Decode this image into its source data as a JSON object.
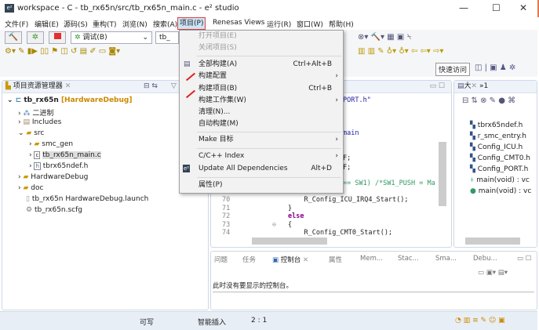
{
  "window": {
    "title": "workspace - C - tb_rx65n/src/tb_rx65n_main.c - e² studio",
    "minimize": "—",
    "maximize": "☐",
    "close": "✕"
  },
  "menubar": [
    "文件(F)",
    "编辑(E)",
    "源码(S)",
    "重构(T)",
    "浏览(N)",
    "搜索(A)",
    "项目(P)",
    "Renesas Views",
    "运行(R)",
    "窗口(W)",
    "帮助(H)"
  ],
  "toolbar": {
    "config_combo": "调试(B)",
    "target_combo": "tb_",
    "quick_access": "快速访问"
  },
  "explorer": {
    "title": "项目资源管理器",
    "items": [
      {
        "label": "tb_rx65n",
        "suffix": "[HardwareDebug]"
      },
      {
        "label": "二进制"
      },
      {
        "label": "Includes"
      },
      {
        "label": "src"
      },
      {
        "label": "smc_gen"
      },
      {
        "label": "tb_rx65n_main.c"
      },
      {
        "label": "tbrx65ndef.h"
      },
      {
        "label": "HardwareDebug"
      },
      {
        "label": "doc"
      },
      {
        "label": "tb_rx65n HardwareDebug.launch"
      },
      {
        "label": "tb_rx65n.scfg"
      }
    ]
  },
  "project_menu": {
    "items": [
      {
        "label": "打开项目(E)",
        "disabled": true
      },
      {
        "label": "关闭项目(S)",
        "disabled": true
      },
      {
        "label": "全部构建(A)",
        "shortcut": "Ctrl+Alt+B"
      },
      {
        "label": "构建配置",
        "submenu": "›"
      },
      {
        "label": "构建项目(B)",
        "shortcut": "Ctrl+B"
      },
      {
        "label": "构建工作集(W)",
        "submenu": "›"
      },
      {
        "label": "清理(N)..."
      },
      {
        "label": "自动构建(M)"
      },
      {
        "label": "Make 目标",
        "submenu": "›"
      },
      {
        "label": "C/C++ Index",
        "submenu": "›"
      },
      {
        "label": "Update All Dependencies",
        "shortcut": "Alt+D"
      },
      {
        "label": "属性(P)"
      }
    ]
  },
  "editor": {
    "lines": [
      {
        "text": "PORT.h\""
      },
      {
        "text": "main"
      },
      {
        "text": "F;"
      },
      {
        "text": "F;"
      },
      {
        "text": "== SW1) /*SW1_PUSH = Ma"
      },
      {
        "num": "70",
        "text": "    R_Config_ICU_IRQ4_Start();"
      },
      {
        "num": "71",
        "text": "}"
      },
      {
        "num": "72",
        "text": "else"
      },
      {
        "num": "73",
        "text": "{"
      },
      {
        "num": "74",
        "text": "    R_Config_CMT0_Start();"
      }
    ]
  },
  "outline": {
    "tab": "大",
    "tab2": "»1",
    "items": [
      "tbrx65ndef.h",
      "r_smc_entry.h",
      "Config_ICU.h",
      "Config_CMT0.h",
      "Config_PORT.h",
      "main(void) : vc",
      "main(void) : vc"
    ]
  },
  "console": {
    "tabs": [
      "问题",
      "任务",
      "控制台",
      "属性",
      "Mem...",
      "Stac...",
      "Sma...",
      "Debu..."
    ],
    "message": "此时没有要显示的控制台。"
  },
  "statusbar": {
    "writable": "可写",
    "insert_mode": "智能插入",
    "position": "2 : 1"
  }
}
